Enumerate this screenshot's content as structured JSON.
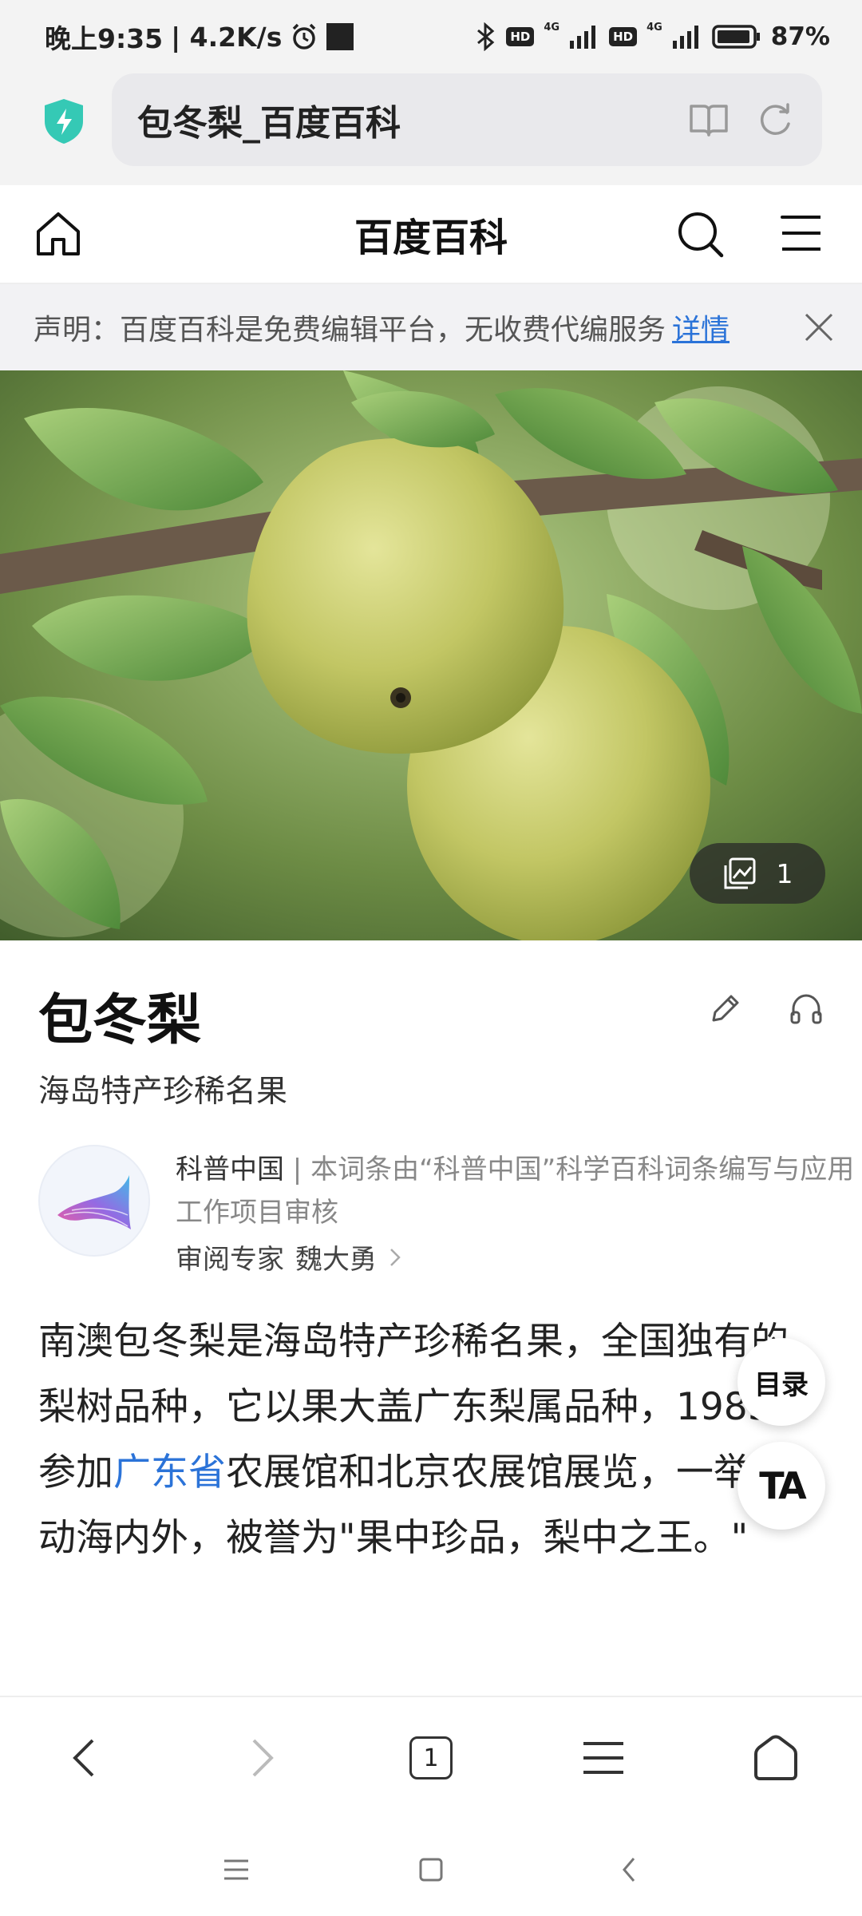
{
  "status_bar": {
    "time": "晚上9:35",
    "net_speed": "| 4.2K/s",
    "hd1": "HD",
    "net1": "4G",
    "hd2": "HD",
    "net2": "4G",
    "battery": "87%"
  },
  "url_bar": {
    "title": "包冬梨_百度百科"
  },
  "site_header": {
    "title": "百度百科"
  },
  "notice": {
    "text": "声明：百度百科是免费编辑平台，无收费代编服务",
    "link": "详情"
  },
  "hero": {
    "photo_count": "1"
  },
  "article": {
    "title": "包冬梨",
    "subtitle": "海岛特产珍稀名果",
    "review_org": "科普中国",
    "review_desc": " | 本词条由“科普中国”科学百科词条编写与应用工作项目审核",
    "review_expert_label": "审阅专家",
    "review_expert_name": "魏大勇",
    "body_part1": "南澳包冬梨是海岛特产珍稀名果，全国独有的梨树品种，它以果大盖广东梨属品种，1985年参加",
    "body_link": "广东省",
    "body_part2": "农展馆和北京农展馆展览，一举轰动海内外，被誉为\"果中珍品，梨中之王。\""
  },
  "floating": {
    "toc_label": "目录",
    "ta_label": "TA"
  },
  "toolbar": {
    "tab_count": "1"
  },
  "colors": {
    "accent_link": "#2b73d8",
    "shield": "#35c9b5"
  }
}
